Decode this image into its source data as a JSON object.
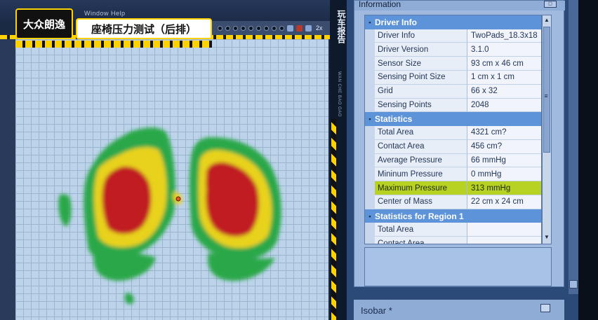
{
  "overlay": {
    "brand": "大众朗逸",
    "test_title": "座椅压力测试（后排）",
    "side_title": "玩车报告",
    "side_subtitle": "WAN CHE BAO GAO"
  },
  "left_window": {
    "menu_text": "Window   Help",
    "zoom_label": "2x"
  },
  "info_panel": {
    "title": "Information",
    "sections": [
      {
        "name": "Driver Info",
        "rows": [
          {
            "key": "Driver Info",
            "value": "TwoPads_18.3x18"
          },
          {
            "key": "Driver Version",
            "value": "3.1.0"
          },
          {
            "key": "Sensor Size",
            "value": "93 cm x 46 cm"
          },
          {
            "key": "Sensing Point Size",
            "value": "1 cm x 1 cm"
          },
          {
            "key": "Grid",
            "value": "66 x 32"
          },
          {
            "key": "Sensing Points",
            "value": "2048"
          }
        ]
      },
      {
        "name": "Statistics",
        "rows": [
          {
            "key": "Total Area",
            "value": "4321 cm?"
          },
          {
            "key": "Contact Area",
            "value": "456 cm?"
          },
          {
            "key": "Average Pressure",
            "value": "66 mmHg"
          },
          {
            "key": "Mininum Pressure",
            "value": "0 mmHg"
          },
          {
            "key": "Maximum Pressure",
            "value": "313 mmHg",
            "highlight": true
          },
          {
            "key": "Center of Mass",
            "value": "22 cm x 24 cm"
          }
        ]
      },
      {
        "name": "Statistics for Region 1",
        "rows": [
          {
            "key": "Total Area",
            "value": ""
          },
          {
            "key": "Contact Area",
            "value": ""
          }
        ]
      }
    ],
    "isobar_label": "Isobar *"
  },
  "colors": {
    "low": "#2aa84a",
    "mid": "#e8d21e",
    "high": "#c01e22",
    "highlight_row": "#b8d224",
    "section_header": "#5d93d8"
  }
}
